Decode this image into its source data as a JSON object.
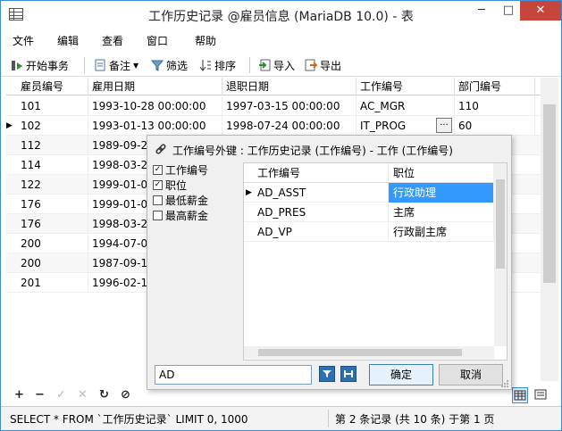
{
  "window": {
    "title": "工作历史记录 @雇员信息 (MariaDB 10.0) - 表",
    "controls": {
      "minimize": "─",
      "maximize": "□",
      "close": "✕"
    }
  },
  "menu": [
    "文件",
    "编辑",
    "查看",
    "窗口",
    "帮助"
  ],
  "toolbar": {
    "begin_transaction": "开始事务",
    "memo": "备注",
    "filter": "筛选",
    "sort": "排序",
    "import": "导入",
    "export": "导出"
  },
  "grid": {
    "columns": [
      "雇员编号",
      "雇用日期",
      "退职日期",
      "工作编号",
      "部门编号"
    ],
    "rows": [
      {
        "emp": "101",
        "hire": "1993-10-28 00:00:00",
        "leave": "1997-03-15 00:00:00",
        "job": "AC_MGR",
        "dept": "110"
      },
      {
        "emp": "102",
        "hire": "1993-01-13 00:00:00",
        "leave": "1998-07-24 00:00:00",
        "job": "IT_PROG",
        "dept": "60"
      },
      {
        "emp": "112",
        "hire": "1989-09-21",
        "leave": "",
        "job": "",
        "dept": ""
      },
      {
        "emp": "114",
        "hire": "1998-03-24",
        "leave": "",
        "job": "",
        "dept": ""
      },
      {
        "emp": "122",
        "hire": "1999-01-01",
        "leave": "",
        "job": "",
        "dept": ""
      },
      {
        "emp": "176",
        "hire": "1999-01-01",
        "leave": "",
        "job": "",
        "dept": ""
      },
      {
        "emp": "176",
        "hire": "1998-03-24",
        "leave": "",
        "job": "",
        "dept": ""
      },
      {
        "emp": "200",
        "hire": "1994-07-01",
        "leave": "",
        "job": "",
        "dept": ""
      },
      {
        "emp": "200",
        "hire": "1987-09-17",
        "leave": "",
        "job": "",
        "dept": ""
      },
      {
        "emp": "201",
        "hire": "1996-02-17",
        "leave": "",
        "job": "",
        "dept": ""
      }
    ],
    "current_row_marker": "▶",
    "ellipsis": "···"
  },
  "popup": {
    "title": "工作编号外键 : 工作历史记录 (工作编号) - 工作 (工作编号)",
    "fields": [
      {
        "label": "工作编号",
        "checked": true
      },
      {
        "label": "职位",
        "checked": true
      },
      {
        "label": "最低薪金",
        "checked": false
      },
      {
        "label": "最高薪金",
        "checked": false
      }
    ],
    "columns": [
      "工作编号",
      "职位"
    ],
    "rows": [
      {
        "code": "AD_ASST",
        "title": "行政助理"
      },
      {
        "code": "AD_PRES",
        "title": "主席"
      },
      {
        "code": "AD_VP",
        "title": "行政副主席"
      }
    ],
    "search_value": "AD",
    "ok": "确定",
    "cancel": "取消",
    "check_mark": "✓"
  },
  "bottom_tools": {
    "add": "+",
    "remove": "−",
    "apply": "✓",
    "discard": "✕",
    "refresh": "↻",
    "stop": "⊘"
  },
  "status": {
    "sql": "SELECT * FROM `工作历史记录` LIMIT 0, 1000",
    "record": "第 2 条记录 (共 10 条) 于第 1 页"
  },
  "colors": {
    "accent": "#3c8dd6",
    "selection": "#3399ff",
    "close": "#c7463b"
  }
}
